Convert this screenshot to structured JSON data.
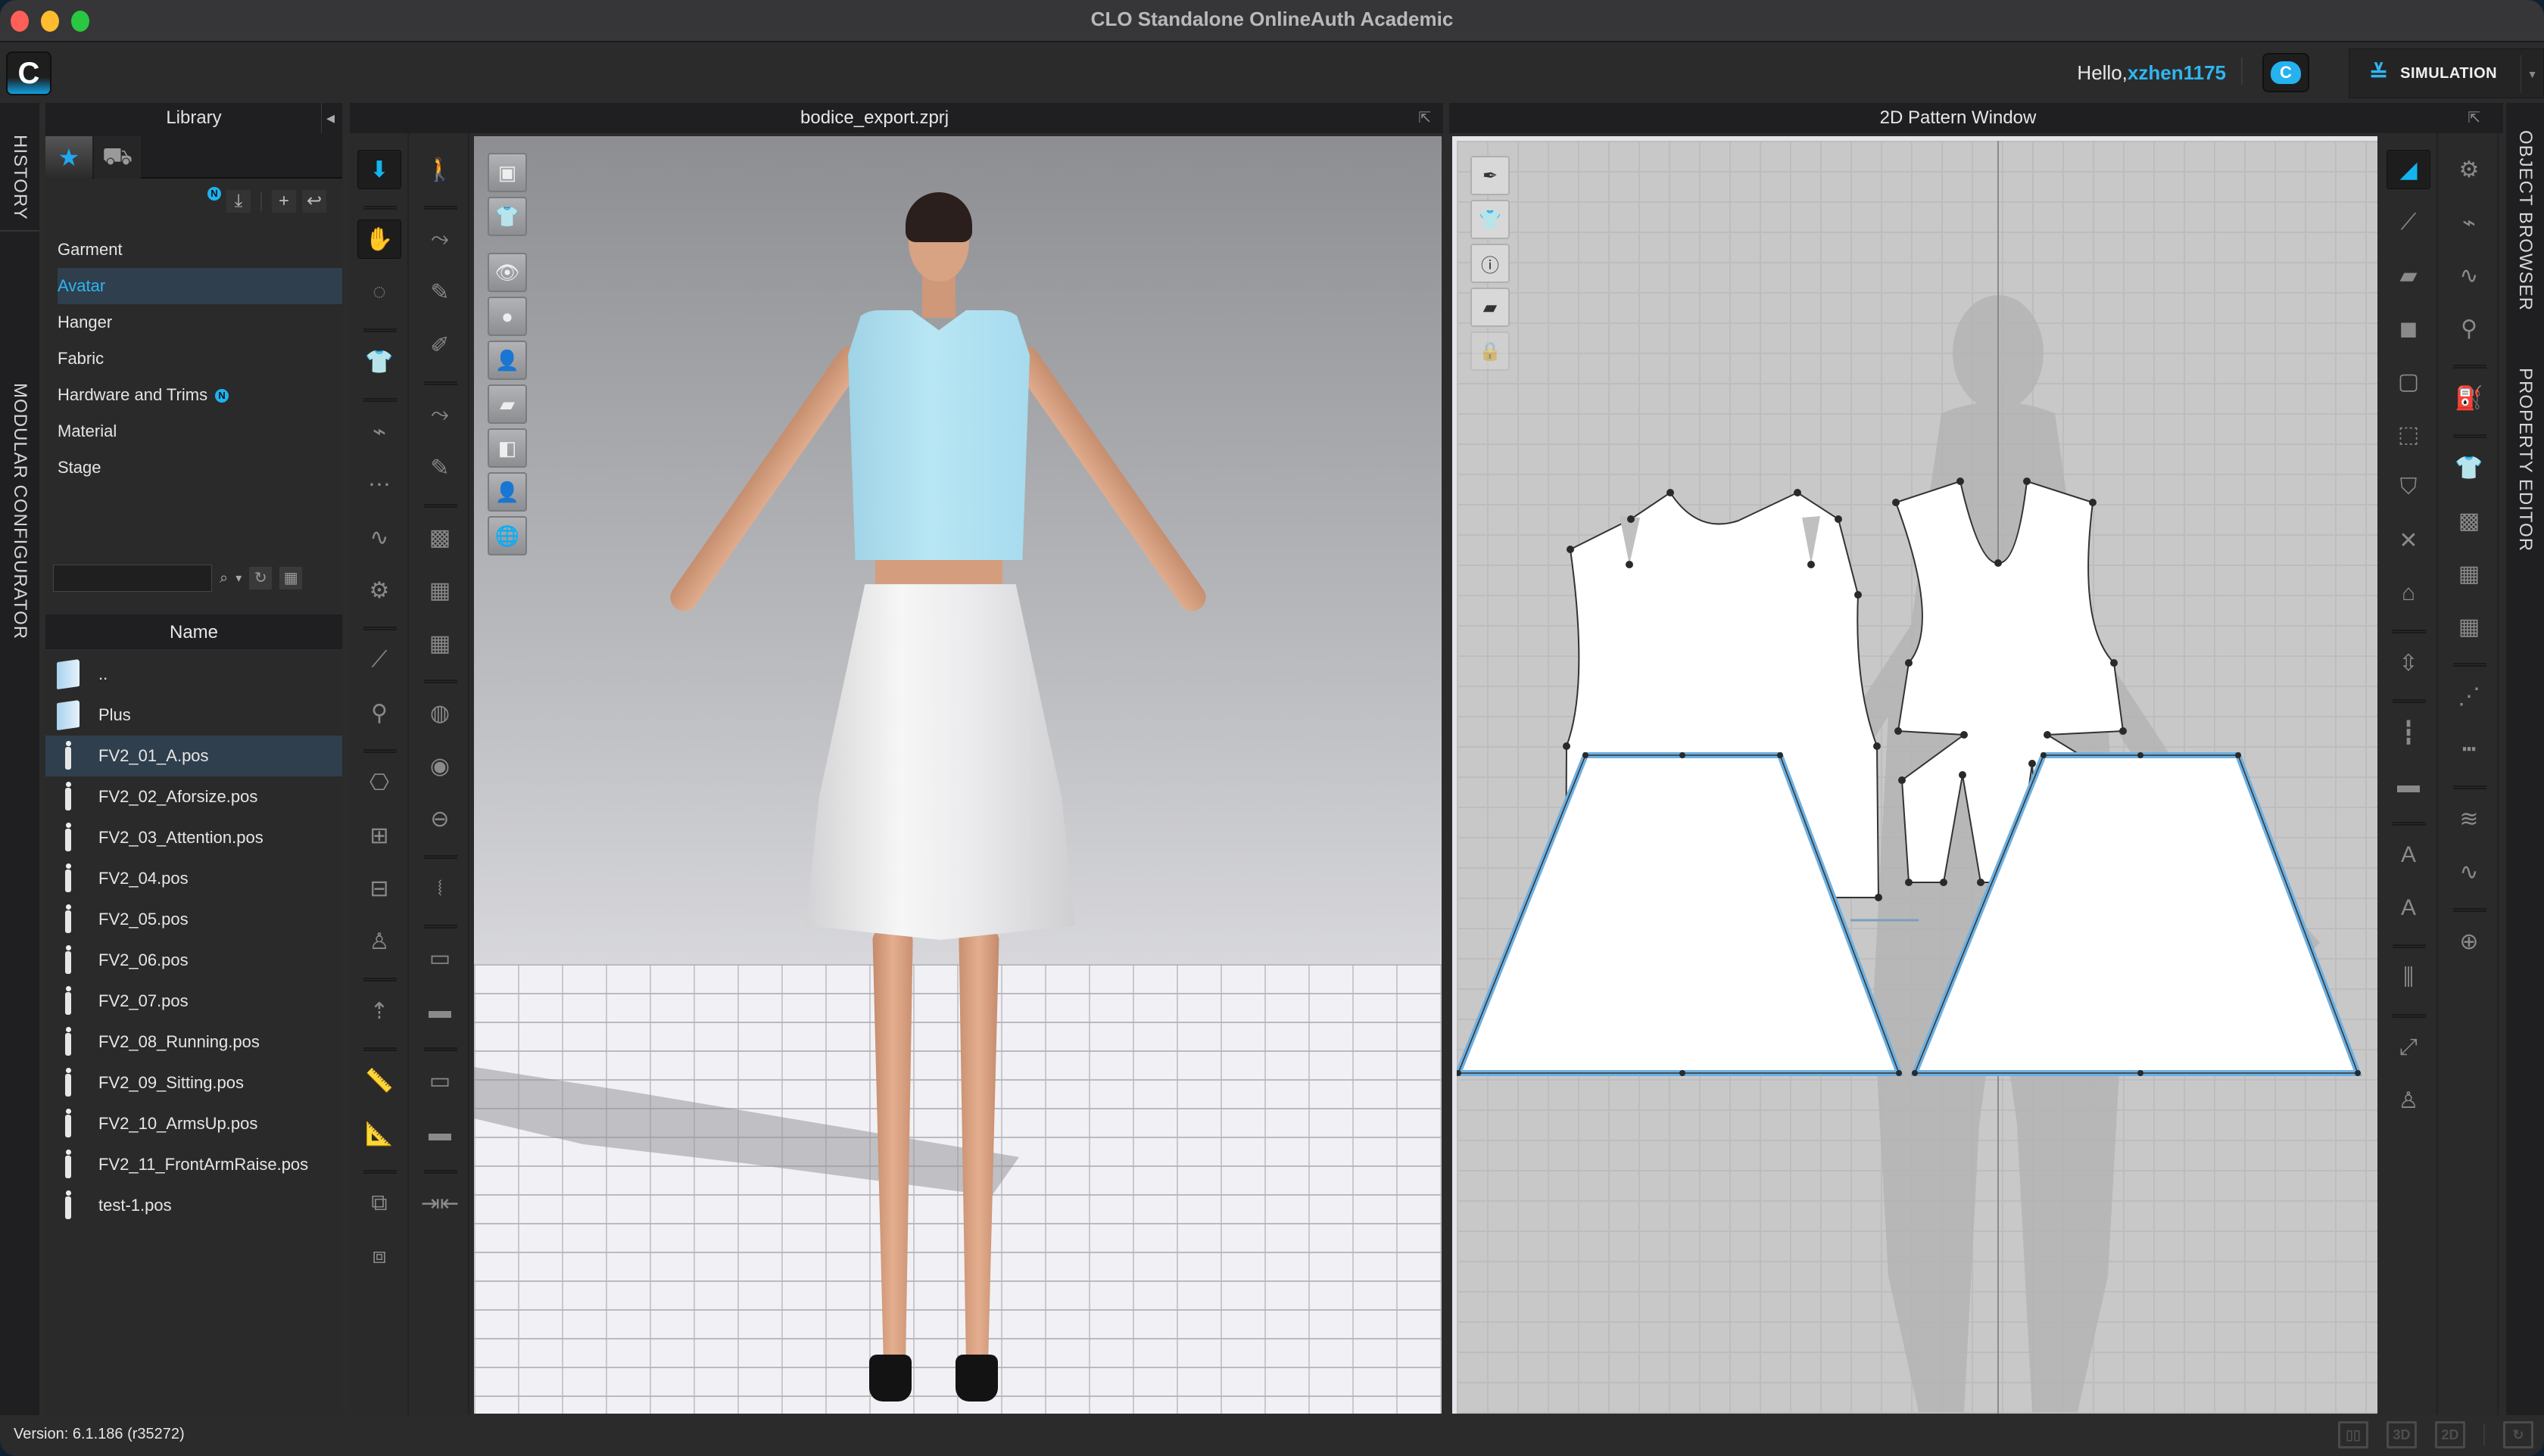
{
  "window": {
    "title": "CLO Standalone OnlineAuth Academic"
  },
  "topbar": {
    "logo_glyph": "C",
    "greeting": "Hello,",
    "username": "xzhen1175",
    "cloud_glyph": "C",
    "mode_chevron": "»",
    "mode_label": "SIMULATION",
    "mode_dropdown": "▼"
  },
  "left_tabs": {
    "history": "HISTORY",
    "modular_configurator": "MODULAR CONFIGURATOR"
  },
  "right_tabs": {
    "object_browser": "OBJECT BROWSER",
    "property_editor": "PROPERTY EDITOR"
  },
  "library": {
    "title": "Library",
    "collapse_glyph": "◂",
    "tabs": [
      {
        "name": "favorites",
        "glyph": "★"
      },
      {
        "name": "store",
        "glyph": "🛍"
      }
    ],
    "new_badge": "N",
    "actions": {
      "download": "⤓",
      "add": "+",
      "back": "↩"
    },
    "categories": [
      {
        "label": "Garment",
        "selected": false,
        "new": false
      },
      {
        "label": "Avatar",
        "selected": true,
        "new": false
      },
      {
        "label": "Hanger",
        "selected": false,
        "new": false
      },
      {
        "label": "Fabric",
        "selected": false,
        "new": false
      },
      {
        "label": "Hardware and Trims",
        "selected": false,
        "new": true
      },
      {
        "label": "Material",
        "selected": false,
        "new": false
      },
      {
        "label": "Stage",
        "selected": false,
        "new": false
      }
    ],
    "search": {
      "value": "",
      "placeholder": "",
      "search_glyph": "⌕",
      "dropdown_glyph": "▾",
      "refresh_glyph": "↻",
      "grid_glyph": "▦"
    },
    "column_header": "Name",
    "files": [
      {
        "name": "..",
        "type": "folder",
        "selected": false
      },
      {
        "name": "Plus",
        "type": "folder",
        "selected": false
      },
      {
        "name": "FV2_01_A.pos",
        "type": "pose",
        "selected": true
      },
      {
        "name": "FV2_02_Aforsize.pos",
        "type": "pose",
        "selected": false
      },
      {
        "name": "FV2_03_Attention.pos",
        "type": "pose",
        "selected": false
      },
      {
        "name": "FV2_04.pos",
        "type": "pose",
        "selected": false
      },
      {
        "name": "FV2_05.pos",
        "type": "pose",
        "selected": false
      },
      {
        "name": "FV2_06.pos",
        "type": "pose",
        "selected": false
      },
      {
        "name": "FV2_07.pos",
        "type": "pose",
        "selected": false
      },
      {
        "name": "FV2_08_Running.pos",
        "type": "pose",
        "selected": false
      },
      {
        "name": "FV2_09_Sitting.pos",
        "type": "pose",
        "selected": false
      },
      {
        "name": "FV2_10_ArmsUp.pos",
        "type": "pose",
        "selected": false
      },
      {
        "name": "FV2_11_FrontArmRaise.pos",
        "type": "pose",
        "selected": false
      },
      {
        "name": "test-1.pos",
        "type": "pose",
        "selected": false
      }
    ]
  },
  "viewport3d": {
    "title": "bodice_export.zprj",
    "popout_glyph": "⇱",
    "side_buttons": [
      {
        "name": "stage-scene-icon",
        "glyph": "▣"
      },
      {
        "name": "garment-display-icon",
        "glyph": "👕"
      },
      {
        "name": "garment-visibility-icon",
        "glyph": "👁"
      },
      {
        "name": "pin-visibility-icon",
        "glyph": "●"
      },
      {
        "name": "avatar-visibility-icon",
        "glyph": "👤"
      },
      {
        "name": "fabric-texture-icon",
        "glyph": "▰"
      },
      {
        "name": "fabric-render-icon",
        "glyph": "◧"
      },
      {
        "name": "avatar-skin-icon",
        "glyph": "👤"
      },
      {
        "name": "globe-icon",
        "glyph": "🌐"
      }
    ]
  },
  "tools3d": {
    "col1": [
      {
        "name": "simulation-tool",
        "glyph": "⬇",
        "active": true,
        "blue": true,
        "sep_before": false
      },
      {
        "name": "select-move-tool",
        "glyph": "✋",
        "active": true,
        "blue": false,
        "sep_before": true
      },
      {
        "name": "select-mesh-brush-tool",
        "glyph": "◌",
        "active": false,
        "blue": false,
        "sep_before": false
      },
      {
        "name": "fold-arrangement-tool",
        "glyph": "👕",
        "active": false,
        "blue": false,
        "sep_before": true
      },
      {
        "name": "segment-sewing-tool",
        "glyph": "⌁",
        "active": false,
        "blue": false,
        "sep_before": true
      },
      {
        "name": "free-sewing-tool",
        "glyph": "⋯",
        "active": false,
        "blue": false,
        "sep_before": false
      },
      {
        "name": "sewing-line-tool",
        "glyph": "∿",
        "active": false,
        "blue": false,
        "sep_before": false
      },
      {
        "name": "show-avatar-seam-tool",
        "glyph": "⚙",
        "active": false,
        "blue": false,
        "sep_before": false
      },
      {
        "name": "pin-tool",
        "glyph": "⟋",
        "active": false,
        "blue": false,
        "sep_before": true
      },
      {
        "name": "pin-box-tool",
        "glyph": "⚲",
        "active": false,
        "blue": false,
        "sep_before": false
      },
      {
        "name": "tack-tool",
        "glyph": "⎔",
        "active": false,
        "blue": false,
        "sep_before": true
      },
      {
        "name": "arrangement-points-tool",
        "glyph": "⊞",
        "active": false,
        "blue": false,
        "sep_before": false
      },
      {
        "name": "reset-arrangement-tool",
        "glyph": "⊟",
        "active": false,
        "blue": false,
        "sep_before": false
      },
      {
        "name": "avatar-arrange-tool",
        "glyph": "♙",
        "active": false,
        "blue": false,
        "sep_before": false
      },
      {
        "name": "remesh-tool",
        "glyph": "⇡",
        "active": false,
        "blue": false,
        "sep_before": true
      },
      {
        "name": "tape-measure-tool",
        "glyph": "📏",
        "active": false,
        "blue": false,
        "sep_before": true
      },
      {
        "name": "measure-tool",
        "glyph": "📐",
        "active": false,
        "blue": false,
        "sep_before": false
      },
      {
        "name": "zipper-select-tool",
        "glyph": "⧉",
        "active": false,
        "blue": false,
        "sep_before": true
      },
      {
        "name": "zipper-tool",
        "glyph": "⧈",
        "active": false,
        "blue": false,
        "sep_before": false
      }
    ],
    "col2": [
      {
        "name": "avatar-pose-tool",
        "glyph": "🚶",
        "sep_before": false
      },
      {
        "name": "edit-curvature-tool",
        "glyph": "⤳",
        "sep_before": true
      },
      {
        "name": "edit-pattern-3d-tool",
        "glyph": "✎",
        "sep_before": false
      },
      {
        "name": "topstitch-3d-tool",
        "glyph": "✐",
        "sep_before": false
      },
      {
        "name": "edit-3d-drawing-tool",
        "glyph": "⤳",
        "sep_before": true
      },
      {
        "name": "draw-3d-line-tool",
        "glyph": "✎",
        "sep_before": false
      },
      {
        "name": "texture-transform-tool",
        "glyph": "▩",
        "sep_before": true
      },
      {
        "name": "graphic-select-tool",
        "glyph": "▦",
        "sep_before": false
      },
      {
        "name": "graphic-tool",
        "glyph": "▦",
        "sep_before": false
      },
      {
        "name": "button-select-tool",
        "glyph": "◍",
        "sep_before": true
      },
      {
        "name": "button-tool",
        "glyph": "◉",
        "sep_before": false
      },
      {
        "name": "buttonhole-tool",
        "glyph": "⊖",
        "sep_before": false
      },
      {
        "name": "zipper-3d-tool",
        "glyph": "⧙",
        "sep_before": true
      },
      {
        "name": "piping-select-tool",
        "glyph": "▭",
        "sep_before": true
      },
      {
        "name": "piping-tool",
        "glyph": "▬",
        "sep_before": false
      },
      {
        "name": "tape-select-tool",
        "glyph": "▭",
        "sep_before": true
      },
      {
        "name": "tape-tool",
        "glyph": "▬",
        "sep_before": false
      },
      {
        "name": "shrink-tool",
        "glyph": "⇥⇤",
        "sep_before": true
      }
    ]
  },
  "viewport2d": {
    "title": "2D Pattern Window",
    "popout_glyph": "⇱",
    "side_buttons": [
      {
        "name": "sewing-visibility-icon",
        "glyph": "✒",
        "dim": false
      },
      {
        "name": "pattern-visibility-icon",
        "glyph": "👕",
        "dim": false
      },
      {
        "name": "info-visibility-icon",
        "glyph": "ⓘ",
        "dim": false
      },
      {
        "name": "fabric-texture-2d-icon",
        "glyph": "▰",
        "dim": false
      },
      {
        "name": "lock-pattern-icon",
        "glyph": "🔒",
        "dim": true
      }
    ],
    "pieces": [
      {
        "name": "bodice-front",
        "type": "bodice"
      },
      {
        "name": "bodice-back",
        "type": "bodice"
      },
      {
        "name": "skirt-front",
        "type": "skirt",
        "selected": true
      },
      {
        "name": "skirt-back",
        "type": "skirt",
        "selected": true
      }
    ],
    "colors": {
      "selected_outline": "#6db0e0",
      "piece_fill": "#ffffff",
      "grid": "#bdbdbd",
      "background": "#c8c8c8"
    }
  },
  "tools2d": {
    "col1": [
      {
        "name": "transform-pattern-tool",
        "glyph": "◢",
        "active": true,
        "blue": true,
        "sep_before": false
      },
      {
        "name": "edit-point-line-tool",
        "glyph": "⟋",
        "sep_before": false
      },
      {
        "name": "polygon-tool",
        "glyph": "▰",
        "sep_before": false
      },
      {
        "name": "rectangle-tool",
        "glyph": "◼",
        "sep_before": false
      },
      {
        "name": "internal-polygon-tool",
        "glyph": "▢",
        "sep_before": false
      },
      {
        "name": "internal-rectangle-tool",
        "glyph": "⬚",
        "sep_before": false
      },
      {
        "name": "dart-tool",
        "glyph": "⛉",
        "sep_before": false
      },
      {
        "name": "edit-curve-point-tool",
        "glyph": "✕",
        "sep_before": false
      },
      {
        "name": "trace-pattern-tool",
        "glyph": "⌂",
        "sep_before": false
      },
      {
        "name": "fold-tool",
        "glyph": "⇳",
        "sep_before": true
      },
      {
        "name": "edit-sewing-tool",
        "glyph": "┇",
        "sep_before": true
      },
      {
        "name": "ruler-tool",
        "glyph": "▬",
        "sep_before": false
      },
      {
        "name": "annotation-select-tool",
        "glyph": "A",
        "sep_before": true
      },
      {
        "name": "annotation-tool",
        "glyph": "A",
        "sep_before": false
      },
      {
        "name": "pleat-tool",
        "glyph": "⫼",
        "sep_before": true
      },
      {
        "name": "grading-tool",
        "glyph": "⤢",
        "sep_before": true
      },
      {
        "name": "avatar-pattern-tool",
        "glyph": "♙",
        "sep_before": false
      }
    ],
    "col2": [
      {
        "name": "edit-sewing-2d-tool",
        "glyph": "⚙",
        "sep_before": false
      },
      {
        "name": "segment-sewing-2d-tool",
        "glyph": "⌁",
        "sep_before": false
      },
      {
        "name": "free-sewing-2d-tool",
        "glyph": "∿",
        "sep_before": false
      },
      {
        "name": "check-sewing-tool",
        "glyph": "⚲",
        "sep_before": false
      },
      {
        "name": "steam-iron-tool",
        "glyph": "⛽",
        "sep_before": true
      },
      {
        "name": "select-trim-tool",
        "glyph": "👕",
        "sep_before": true
      },
      {
        "name": "texture-transform-2d-tool",
        "glyph": "▩",
        "sep_before": false
      },
      {
        "name": "graphic-select-2d-tool",
        "glyph": "▦",
        "sep_before": false
      },
      {
        "name": "graphic-2d-tool",
        "glyph": "▦",
        "sep_before": false
      },
      {
        "name": "topstitch-select-tool",
        "glyph": "⋰",
        "sep_before": true
      },
      {
        "name": "topstitch-segment-tool",
        "glyph": "┅",
        "sep_before": false
      },
      {
        "name": "elastic-select-tool",
        "glyph": "≋",
        "sep_before": true
      },
      {
        "name": "elastic-segment-tool",
        "glyph": "∿",
        "sep_before": false
      },
      {
        "name": "merge-pattern-tool",
        "glyph": "⊕",
        "sep_before": true
      }
    ]
  },
  "statusbar": {
    "version": "Version: 6.1.186 (r35272)",
    "layout_buttons": [
      {
        "name": "split-view-button",
        "label": "▯▯"
      },
      {
        "name": "view-3d-button",
        "label": "3D"
      },
      {
        "name": "view-2d-button",
        "label": "2D"
      }
    ],
    "refresh_glyph": "↻"
  }
}
